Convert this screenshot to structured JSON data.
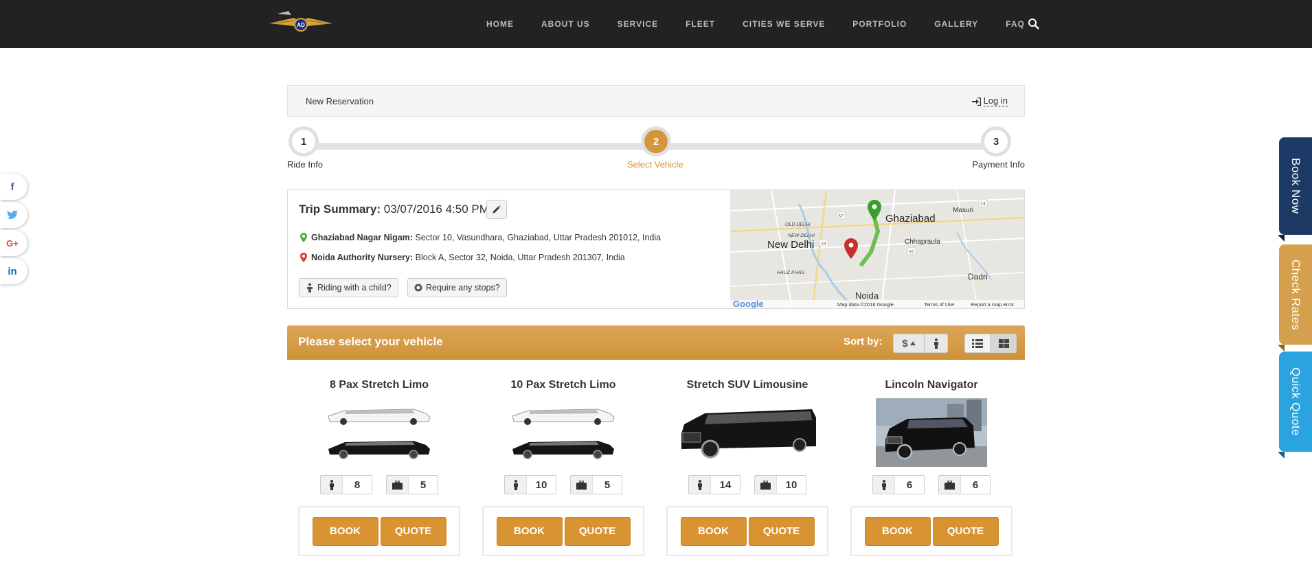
{
  "nav": {
    "items": [
      "HOME",
      "ABOUT US",
      "SERVICE",
      "FLEET",
      "CITIES WE SERVE",
      "PORTFOLIO",
      "GALLERY",
      "FAQ"
    ],
    "logo_text": "AD"
  },
  "reservation": {
    "title": "New Reservation",
    "login_label": "Log in"
  },
  "steps": [
    {
      "number": "1",
      "label": "Ride Info"
    },
    {
      "number": "2",
      "label": "Select Vehicle"
    },
    {
      "number": "3",
      "label": "Payment Info"
    }
  ],
  "active_step": 2,
  "trip": {
    "title": "Trip Summary:",
    "datetime": "03/07/2016 4:50 PM",
    "pickup_name": "Ghaziabad Nagar Nigam:",
    "pickup_address": "Sector 10, Vasundhara, Ghaziabad, Uttar Pradesh 201012, India",
    "dropoff_name": "Noida Authority Nursery:",
    "dropoff_address": "Block A, Sector 32, Noida, Uttar Pradesh 201307, India",
    "child_label": "Riding with a child?",
    "stops_label": "Require any stops?"
  },
  "map": {
    "labels": [
      "Ghaziabad",
      "New Delhi",
      "OLD DELHI",
      "NEW DELHI",
      "Masuri",
      "Chhapraula",
      "HAUZ KHAS",
      "Dadri",
      "Noida"
    ],
    "road_numbers": [
      "24",
      "57",
      "24",
      "91"
    ],
    "footer": [
      "Map data ©2016 Google",
      "Terms of Use",
      "Report a map error"
    ],
    "brand": "Google"
  },
  "vehicle_header": {
    "title": "Please select your vehicle",
    "sort_label": "Sort by:",
    "sort_price": "$"
  },
  "vehicles": [
    {
      "name": "8 Pax Stretch Limo",
      "passengers": "8",
      "luggage": "5"
    },
    {
      "name": "10 Pax Stretch Limo",
      "passengers": "10",
      "luggage": "5"
    },
    {
      "name": "Stretch SUV Limousine",
      "passengers": "14",
      "luggage": "10"
    },
    {
      "name": "Lincoln Navigator",
      "passengers": "6",
      "luggage": "6"
    }
  ],
  "buttons": {
    "book": "BOOK",
    "quote": "QUOTE"
  },
  "social": [
    {
      "icon": "facebook-icon",
      "glyph": "f",
      "color": "#3b5998"
    },
    {
      "icon": "twitter-icon",
      "glyph": "t",
      "color": "#55acee"
    },
    {
      "icon": "google-plus-icon",
      "glyph": "G+",
      "color": "#dd4b39"
    },
    {
      "icon": "linkedin-icon",
      "glyph": "in",
      "color": "#0077b5"
    }
  ],
  "side_tabs": [
    {
      "label": "Book Now",
      "color": "#1d3a66"
    },
    {
      "label": "Check Rates",
      "color": "#d4a04e"
    },
    {
      "label": "Quick Quote",
      "color": "#2aa3df"
    }
  ],
  "colors": {
    "accent": "#d4953b",
    "topbar": "#222222"
  }
}
